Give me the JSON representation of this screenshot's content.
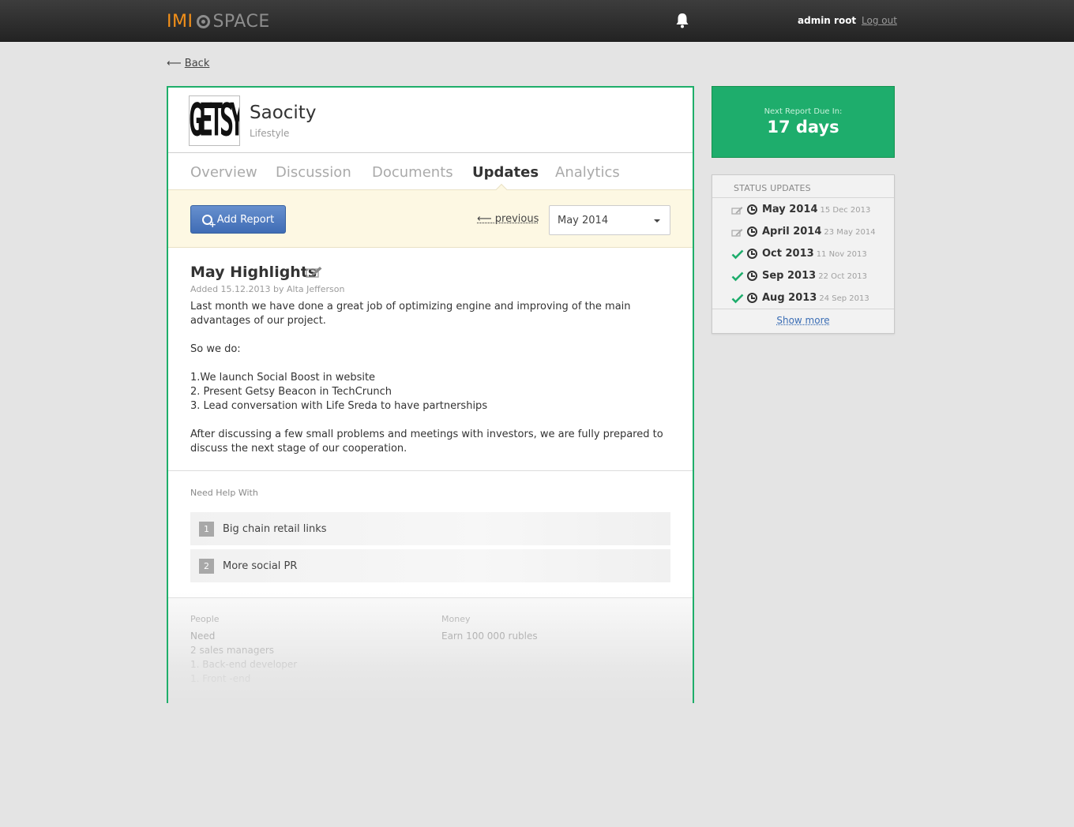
{
  "header": {
    "logo_left": "IMI",
    "logo_right": "SPACE",
    "user_name": "admin root",
    "logout_label": "Log out"
  },
  "nav": {
    "back_label": "Back"
  },
  "project": {
    "logo_text": "GETSY",
    "name": "Saocity",
    "category": "Lifestyle"
  },
  "tabs": [
    {
      "label": "Overview",
      "active": false
    },
    {
      "label": "Discussion",
      "active": false
    },
    {
      "label": "Documents",
      "active": false
    },
    {
      "label": "Updates",
      "active": true
    },
    {
      "label": "Analytics",
      "active": false
    }
  ],
  "toolbar": {
    "add_report_label": "Add Report",
    "previous_label": "previous",
    "selected_month": "May 2014"
  },
  "post": {
    "title": "May Highlights",
    "meta": "Added 15.12.2013 by Alta Jefferson",
    "paragraphs": [
      "Last month we have done a great job of optimizing engine and improving of the main advantages of our project.",
      "So we do:",
      "1.We launch Social Boost in website\n2. Present Getsy Beacon in TechCrunch\n3. Lead conversation with Life Sreda to have partnerships",
      "After discussing a few small problems and meetings with investors, we are fully prepared to discuss the next stage of our cooperation."
    ]
  },
  "help": {
    "title": "Need Help With",
    "items": [
      {
        "num": "1",
        "text": "Big chain retail links"
      },
      {
        "num": "2",
        "text": "More social PR"
      }
    ]
  },
  "needs": {
    "people": {
      "label": "People",
      "lines": [
        "Need",
        "2 sales managers",
        "1. Back-end developer",
        "1. Front -end"
      ]
    },
    "money": {
      "label": "Money",
      "lines": [
        "Earn 100 000 rubles"
      ]
    }
  },
  "due": {
    "label": "Next Report Due In:",
    "value": "17 days"
  },
  "status": {
    "title": "STATUS UPDATES",
    "items": [
      {
        "label": "May 2014",
        "date": "15 Dec 2013",
        "state": "edit"
      },
      {
        "label": "April 2014",
        "date": "23 May 2014",
        "state": "edit"
      },
      {
        "label": "Oct 2013",
        "date": "11 Nov 2013",
        "state": "done"
      },
      {
        "label": "Sep 2013",
        "date": "22 Oct 2013",
        "state": "done"
      },
      {
        "label": "Aug 2013",
        "date": "24 Sep 2013",
        "state": "done"
      }
    ],
    "show_more_label": "Show more"
  },
  "colors": {
    "accent_green": "#1ead6c",
    "logo_orange": "#f39019",
    "button_blue": "#3f6cb5"
  }
}
